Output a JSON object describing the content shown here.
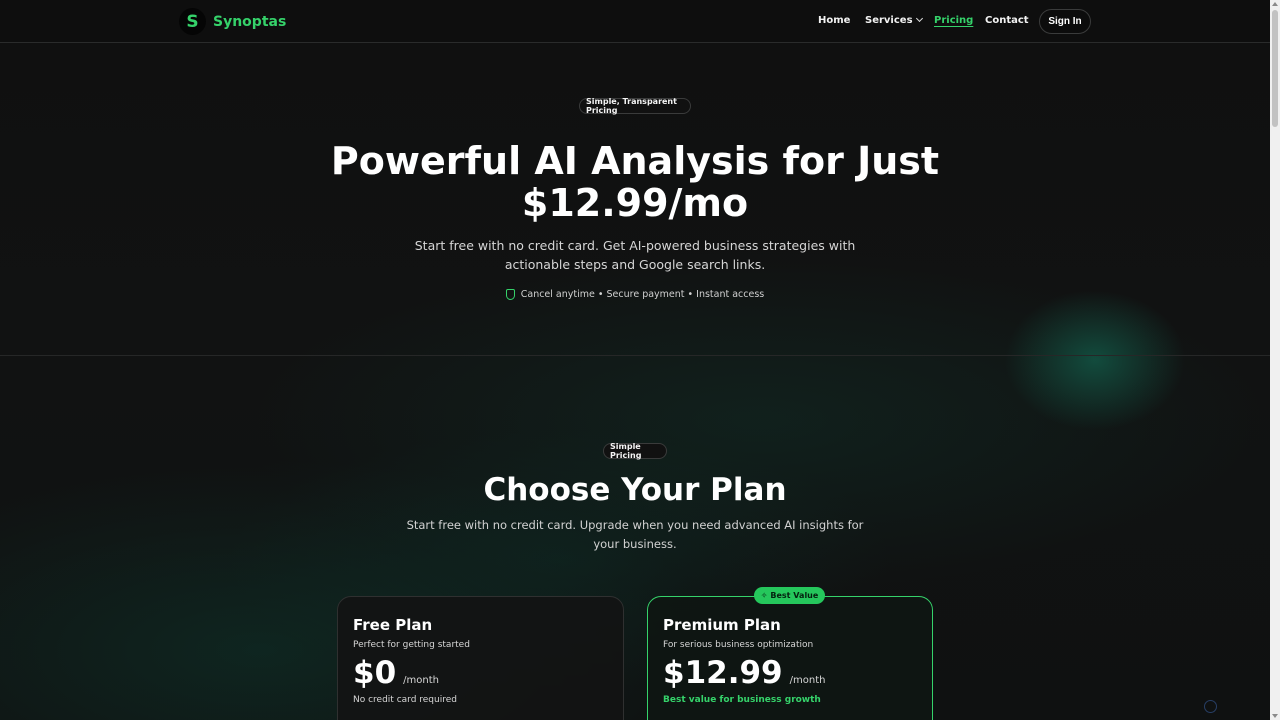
{
  "nav": {
    "logo_letter": "S",
    "brand": "Synoptas",
    "links": [
      "Home",
      "Services",
      "Pricing",
      "Contact"
    ],
    "active_link": "Pricing",
    "signin": "Sign In"
  },
  "hero": {
    "pill": "Simple, Transparent Pricing",
    "title_line1": "Powerful AI Analysis for Just",
    "title_line2": "$12.99/mo",
    "subtitle": "Start free with no credit card. Get AI-powered business strategies with actionable steps and Google search links.",
    "trust": "Cancel anytime • Secure payment • Instant access"
  },
  "plans_section": {
    "pill": "Simple Pricing",
    "title": "Choose Your Plan",
    "subtitle": "Start free with no credit card. Upgrade when you need advanced AI insights for your business."
  },
  "plans": [
    {
      "name": "Free Plan",
      "desc": "Perfect for getting started",
      "price": "$0",
      "per": "/month",
      "note": "No credit card required"
    },
    {
      "name": "Premium Plan",
      "desc": "For serious business optimization",
      "price": "$12.99",
      "per": "/month",
      "note": "Best value for business growth",
      "badge": "Best Value"
    }
  ],
  "colors": {
    "accent": "#35d26a",
    "background": "#0d0e0e"
  }
}
